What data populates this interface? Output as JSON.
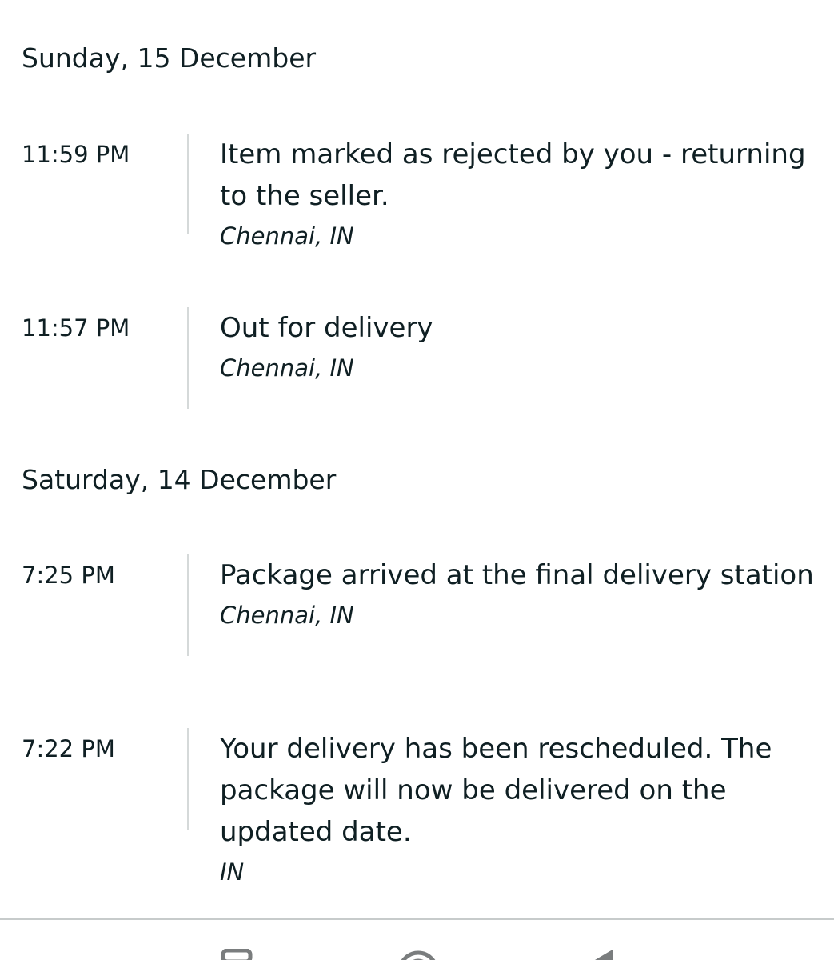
{
  "days": [
    {
      "date": "Sunday, 15 December",
      "events": [
        {
          "time": "11:59 PM",
          "description": "Item marked as rejected by you - returning to the seller.",
          "location": "Chennai, IN"
        },
        {
          "time": "11:57 PM",
          "description": "Out for delivery",
          "location": "Chennai, IN"
        }
      ]
    },
    {
      "date": "Saturday, 14 December",
      "events": [
        {
          "time": "7:25 PM",
          "description": "Package arrived at the final delivery station",
          "location": "Chennai, IN"
        },
        {
          "time": "7:22 PM",
          "description": "Your delivery has been rescheduled. The package will now be delivered on the updated date.",
          "location": "IN"
        }
      ]
    }
  ],
  "navigation": {
    "icons": [
      "recent-apps-icon",
      "home-icon",
      "back-icon"
    ]
  },
  "colors": {
    "text": "#0f1f23",
    "rule": "#d5d9d9",
    "divider": "#c7cbcb"
  }
}
